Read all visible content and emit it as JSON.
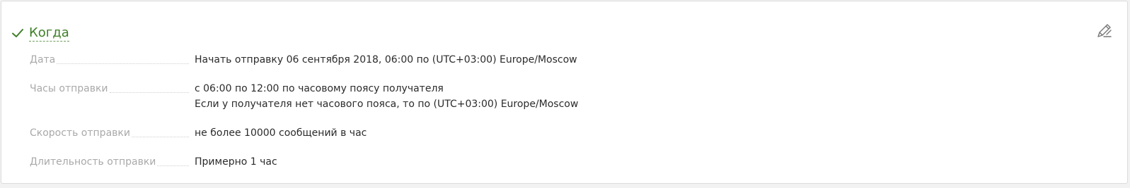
{
  "section": {
    "title": "Когда",
    "icons": {
      "status": "checkmark-icon",
      "edit": "pencil-edit-icon"
    },
    "colors": {
      "title": "#3f7f28",
      "label": "#a9a9a9",
      "value": "#2b2b2b"
    }
  },
  "rows": [
    {
      "label": "Дата",
      "lines": [
        "Начать отправку 06 сентября 2018, 06:00 по (UTC+03:00) Europe/Moscow"
      ]
    },
    {
      "label": "Часы отправки",
      "lines": [
        "с 06:00 по 12:00 по часовому поясу получателя",
        "Если у получателя нет часового пояса, то по (UTC+03:00) Europe/Moscow"
      ]
    },
    {
      "label": "Скорость отправки",
      "lines": [
        "не более 10000 сообщений в час"
      ]
    },
    {
      "label": "Длительность отправки",
      "lines": [
        "Примерно 1 час"
      ]
    }
  ]
}
